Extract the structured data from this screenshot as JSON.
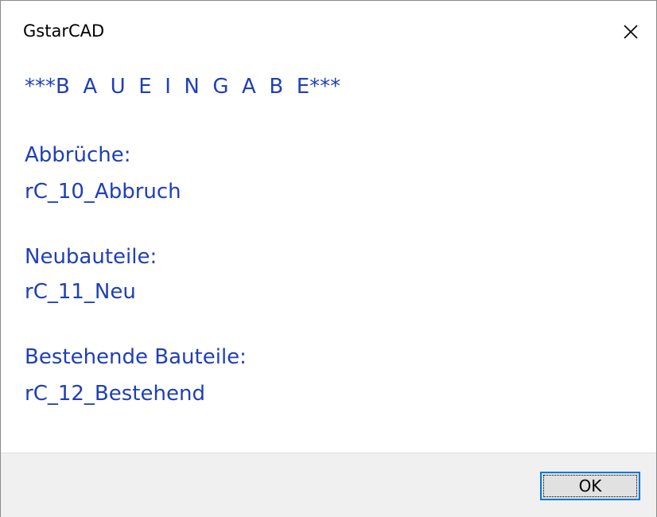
{
  "window": {
    "title": "GstarCAD",
    "close_icon": "close-icon"
  },
  "message": {
    "heading": "***B  A  U  E  I  N  G  A  B  E***",
    "lines": [
      "Abbrüche:",
      "rC_10_Abbruch",
      "Neubauteile:",
      "rC_11_Neu",
      "Bestehende Bauteile:",
      "rC_12_Bestehend"
    ],
    "text_color": "#1f3fb8"
  },
  "footer": {
    "ok_label": "OK",
    "accent": "#0078d7"
  }
}
